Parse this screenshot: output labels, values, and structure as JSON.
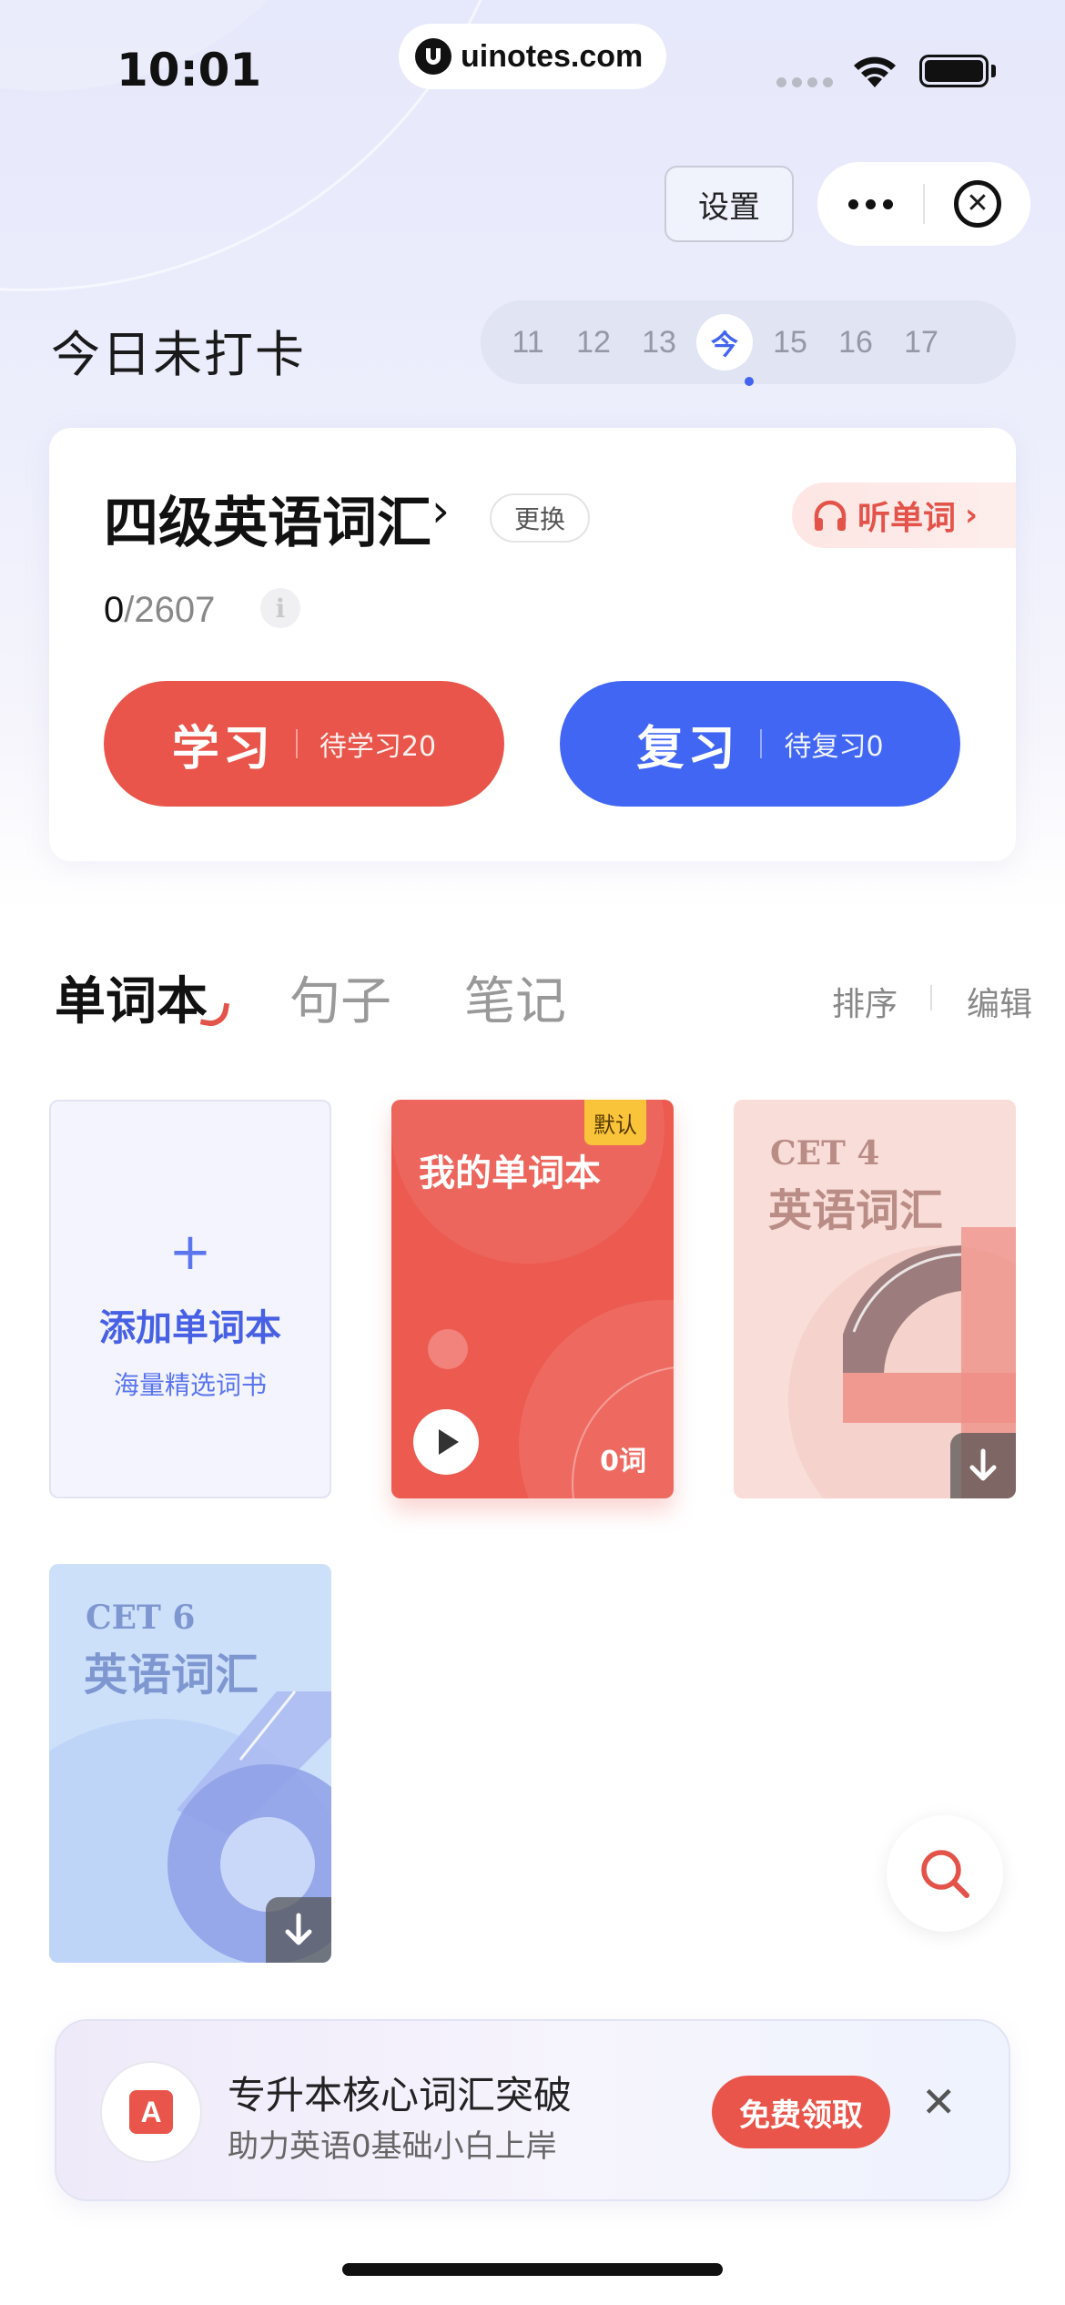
{
  "status_bar": {
    "time": "10:01",
    "url": "uinotes.com"
  },
  "header": {
    "settings_label": "设置",
    "more_icon": "more-dots-icon",
    "close_icon": "close-circle-icon"
  },
  "checkin": {
    "title": "今日未打卡",
    "dates": [
      "11",
      "12",
      "13",
      "今",
      "15",
      "16",
      "17"
    ],
    "accent": "#4264f0"
  },
  "book": {
    "name": "四级英语词汇",
    "switch_label": "更换",
    "listen_label": "听单词",
    "progress_done": "0",
    "progress_total": "/2607",
    "learn": {
      "label": "学习",
      "pending": "待学习20",
      "color": "#e9554a"
    },
    "review": {
      "label": "复习",
      "pending": "待复习0",
      "color": "#4266f4"
    }
  },
  "tabs": {
    "items": [
      "单词本",
      "句子",
      "笔记"
    ],
    "active": "单词本",
    "sort_label": "排序",
    "edit_label": "编辑"
  },
  "wordbooks": {
    "add": {
      "title": "添加单词本",
      "subtitle": "海量精选词书"
    },
    "mine": {
      "title": "我的单词本",
      "tag": "默认",
      "count": "0词"
    },
    "cet4": {
      "code": "CET 4",
      "title": "英语词汇"
    },
    "cet6": {
      "code": "CET 6",
      "title": "英语词汇"
    }
  },
  "promo": {
    "title": "专升本核心词汇突破",
    "subtitle": "助力英语0基础小白上岸",
    "button": "免费领取",
    "logo_letter": "A"
  }
}
